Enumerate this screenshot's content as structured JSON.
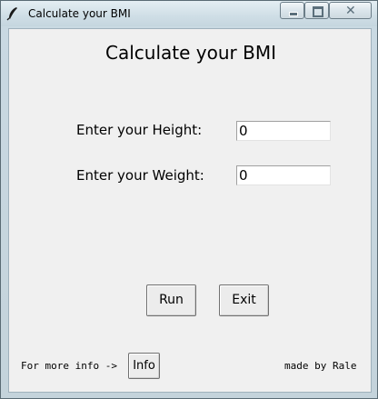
{
  "window": {
    "title": "Calculate your BMI",
    "icon": "feather-icon",
    "controls": {
      "minimize": "minimize-icon",
      "maximize": "maximize-icon",
      "close": "✕"
    }
  },
  "form": {
    "heading": "Calculate your BMI",
    "height_label": "Enter your Height:",
    "height_value": "0",
    "weight_label": "Enter your Weight:",
    "weight_value": "0"
  },
  "actions": {
    "run_label": "Run",
    "exit_label": "Exit"
  },
  "footer": {
    "more_info_text": "For more info ->",
    "info_label": "Info",
    "credit": "made by Rale"
  }
}
